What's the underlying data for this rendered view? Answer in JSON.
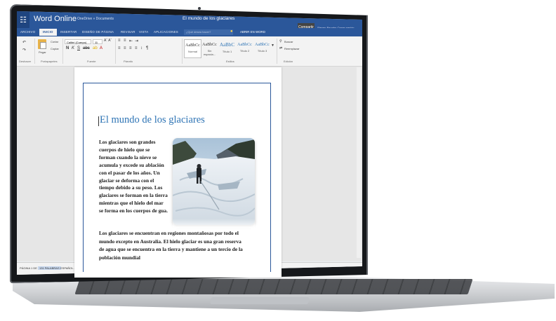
{
  "app": {
    "name": "Word Online",
    "breadcrumb": "OneDrive » Documents",
    "document_title": "El mundo de los glaciares",
    "share_label": "Compartir",
    "user_area": "Steven Baughn  Cerrar sesión"
  },
  "tabs": [
    "ARCHIVO",
    "INICIO",
    "INSERTAR",
    "DISEÑO DE PÁGINA",
    "REVISAR",
    "VISTA",
    "APLICACIONES"
  ],
  "active_tab": "INICIO",
  "tell_me": {
    "placeholder": "¿Qué desea hacer?"
  },
  "open_in_word": "ABRIR EN WORD",
  "ribbon": {
    "undo_label": "Deshacer",
    "paste_label": "Pegar",
    "cut_label": "Cortar",
    "copy_label": "Copiar",
    "clipboard_label": "Portapapeles",
    "font_name": "Calibri (Cuerpo)",
    "font_size": "11",
    "font_group_label": "Fuente",
    "paragraph_group_label": "Párrafo",
    "styles_group_label": "Estilos",
    "edit_group_label": "Edición",
    "find_label": "Buscar",
    "replace_label": "Reemplazar",
    "styles": [
      {
        "sample": "AaBbCc",
        "name": "Normal"
      },
      {
        "sample": "AaBbCc",
        "name": "Sin espacia..."
      },
      {
        "sample": "AaBbC",
        "name": "Título 1"
      },
      {
        "sample": "AaBbCc",
        "name": "Título 2"
      },
      {
        "sample": "AaBbCc",
        "name": "Título 3"
      }
    ]
  },
  "document": {
    "heading": "El mundo de los glaciares",
    "wrapped_lines": [
      "Los glaciares son grandes",
      "cuerpos de hielo que se",
      "forman cuando la nieve se",
      "acumula y excede su ablación",
      "con el pasar de los años. Un",
      "glaciar se deforma con el",
      "tiempo debido a su peso. Los",
      "glaciares se forman en la tierra",
      "mientras que el hielo del mar",
      "se forma en los cuerpos de gua."
    ],
    "full_lines": [
      "Los glaciares se encuentran en regiones montañosas por todo el",
      "mundo excepto en Australia. El hielo glaciar es una gran reserva",
      "de agua que se encuentra en la tierra y mantiene a un tercio de la",
      "población mundial"
    ]
  },
  "status": {
    "page": "PÁGINA 1 DE 1",
    "words": "131 PALABRAS",
    "language": "ESPAÑOL (ARG. INTERNACIONAL)",
    "saved": "GUARDADO EN ONEDRIVE",
    "help": "AYUDA A MEJORAR OFFICE"
  },
  "colors": {
    "word_blue": "#2b579a",
    "heading_blue": "#2e74b5"
  }
}
